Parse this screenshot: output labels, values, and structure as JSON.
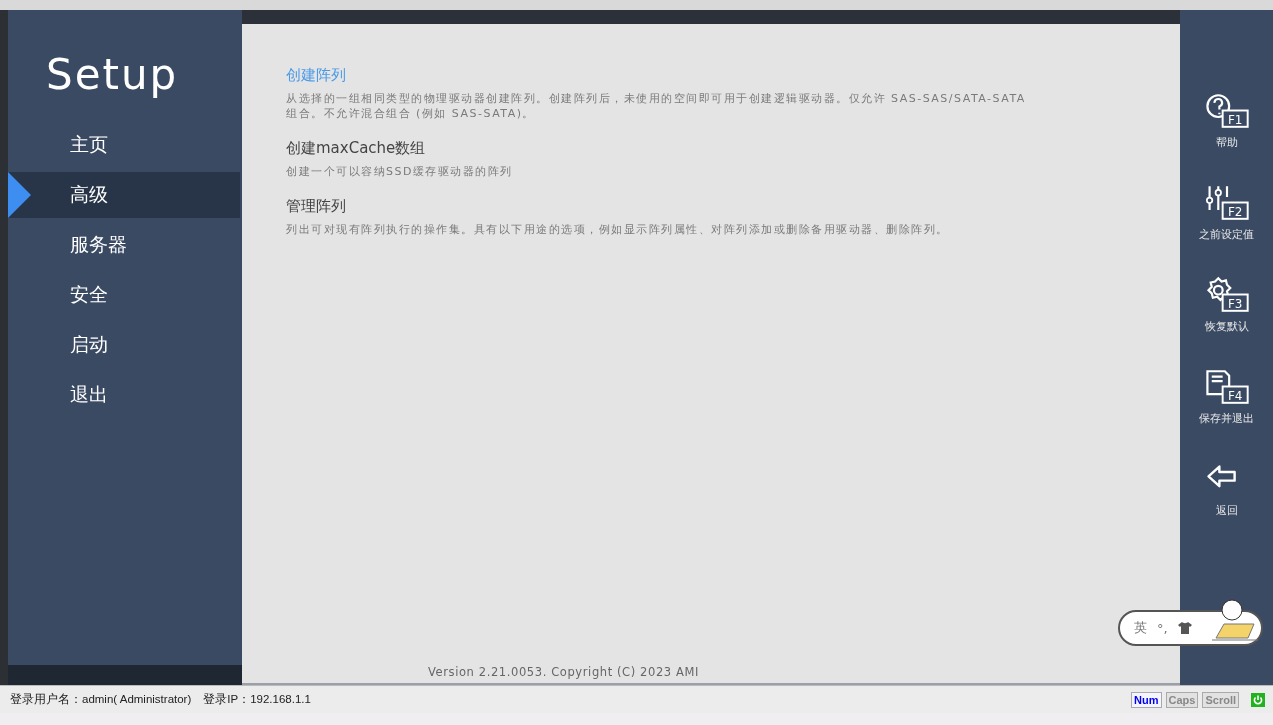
{
  "sidebar": {
    "title": "Setup",
    "items": [
      {
        "label": "主页",
        "selected": false
      },
      {
        "label": "高级",
        "selected": true
      },
      {
        "label": "服务器",
        "selected": false
      },
      {
        "label": "安全",
        "selected": false
      },
      {
        "label": "启动",
        "selected": false
      },
      {
        "label": "退出",
        "selected": false
      }
    ]
  },
  "options": [
    {
      "title": "创建阵列",
      "selected": true,
      "description": "从选择的一组相同类型的物理驱动器创建阵列。创建阵列后，未使用的空间即可用于创建逻辑驱动器。仅允许 SAS-SAS/SATA-SATA 组合。不允许混合组合 (例如 SAS-SATA)。"
    },
    {
      "title": "创建maxCache数组",
      "selected": false,
      "description": "创建一个可以容纳SSD缓存驱动器的阵列"
    },
    {
      "title": "管理阵列",
      "selected": false,
      "description": "列出可对现有阵列执行的操作集。具有以下用途的选项，例如显示阵列属性、对阵列添加或删除备用驱动器、删除阵列。"
    }
  ],
  "version": "Version 2.21.0053. Copyright (C) 2023 AMI",
  "hotkeys": [
    {
      "kind": "help",
      "key": "F1",
      "label": "帮助"
    },
    {
      "kind": "previous",
      "key": "F2",
      "label": "之前设定值"
    },
    {
      "kind": "defaults",
      "key": "F3",
      "label": "恢复默认"
    },
    {
      "kind": "save",
      "key": "F4",
      "label": "保存并退出"
    },
    {
      "kind": "back",
      "label": "返回"
    }
  ],
  "ime": {
    "mode": "英",
    "punctuation": "°,"
  },
  "status_bar": {
    "user": "登录用户名：admin( Administrator)",
    "ip": "登录IP：192.168.1.1",
    "indicators": [
      {
        "label": "Num",
        "on": true
      },
      {
        "label": "Caps",
        "on": false
      },
      {
        "label": "Scroll",
        "on": false
      }
    ]
  }
}
